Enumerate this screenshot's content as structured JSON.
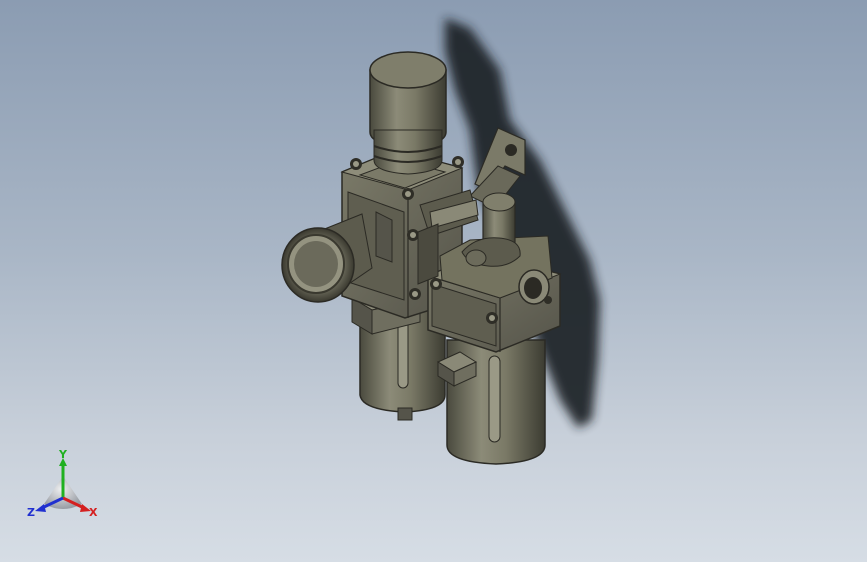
{
  "viewport": {
    "background_top": "#8b9cb2",
    "background_bottom": "#d6dde5",
    "model_body_color": "#6f6e5f",
    "model_dark_color": "#3d3c32",
    "shadow_color": "#1e2024"
  },
  "triad": {
    "x_label": "X",
    "y_label": "Y",
    "z_label": "Z",
    "x_color": "#d42020",
    "y_color": "#20b020",
    "z_color": "#2030d0"
  }
}
